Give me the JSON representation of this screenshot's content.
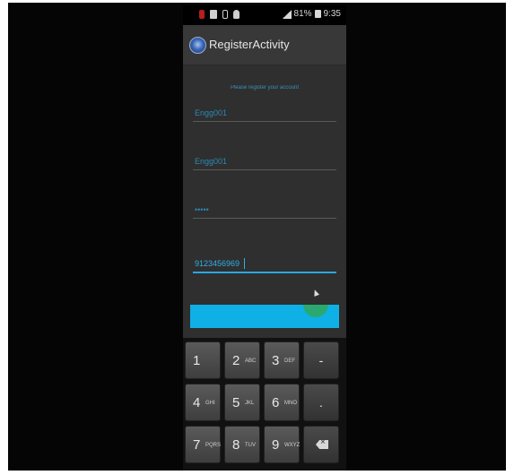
{
  "status_bar": {
    "battery_text": "81%",
    "time": "9:35"
  },
  "action_bar": {
    "title": "RegisterActivity",
    "icon": "app-icon"
  },
  "form": {
    "hint": "Please register your account",
    "fields": [
      {
        "name": "first-name-field",
        "value": "Engg001"
      },
      {
        "name": "last-name-field",
        "value": "Engg001"
      },
      {
        "name": "password-field",
        "value": "•••••"
      },
      {
        "name": "phone-field",
        "value": "9123456969"
      }
    ],
    "button_label": ""
  },
  "keyboard": {
    "rows": [
      [
        {
          "n": "1",
          "l": ""
        },
        {
          "n": "2",
          "l": "ABC"
        },
        {
          "n": "3",
          "l": "DEF"
        },
        {
          "s": "-"
        }
      ],
      [
        {
          "n": "4",
          "l": "GHI"
        },
        {
          "n": "5",
          "l": "JKL"
        },
        {
          "n": "6",
          "l": "MNO"
        },
        {
          "s": "."
        }
      ],
      [
        {
          "n": "7",
          "l": "PQRS"
        },
        {
          "n": "8",
          "l": "TUV"
        },
        {
          "n": "9",
          "l": "WXYZ"
        },
        {
          "icon": "backspace-icon"
        }
      ]
    ]
  },
  "colors": {
    "accent": "#28a8e0",
    "button": "#0fb0e6",
    "touch_green": "#2ea85a",
    "tap_yellow": "#e6d94a"
  }
}
